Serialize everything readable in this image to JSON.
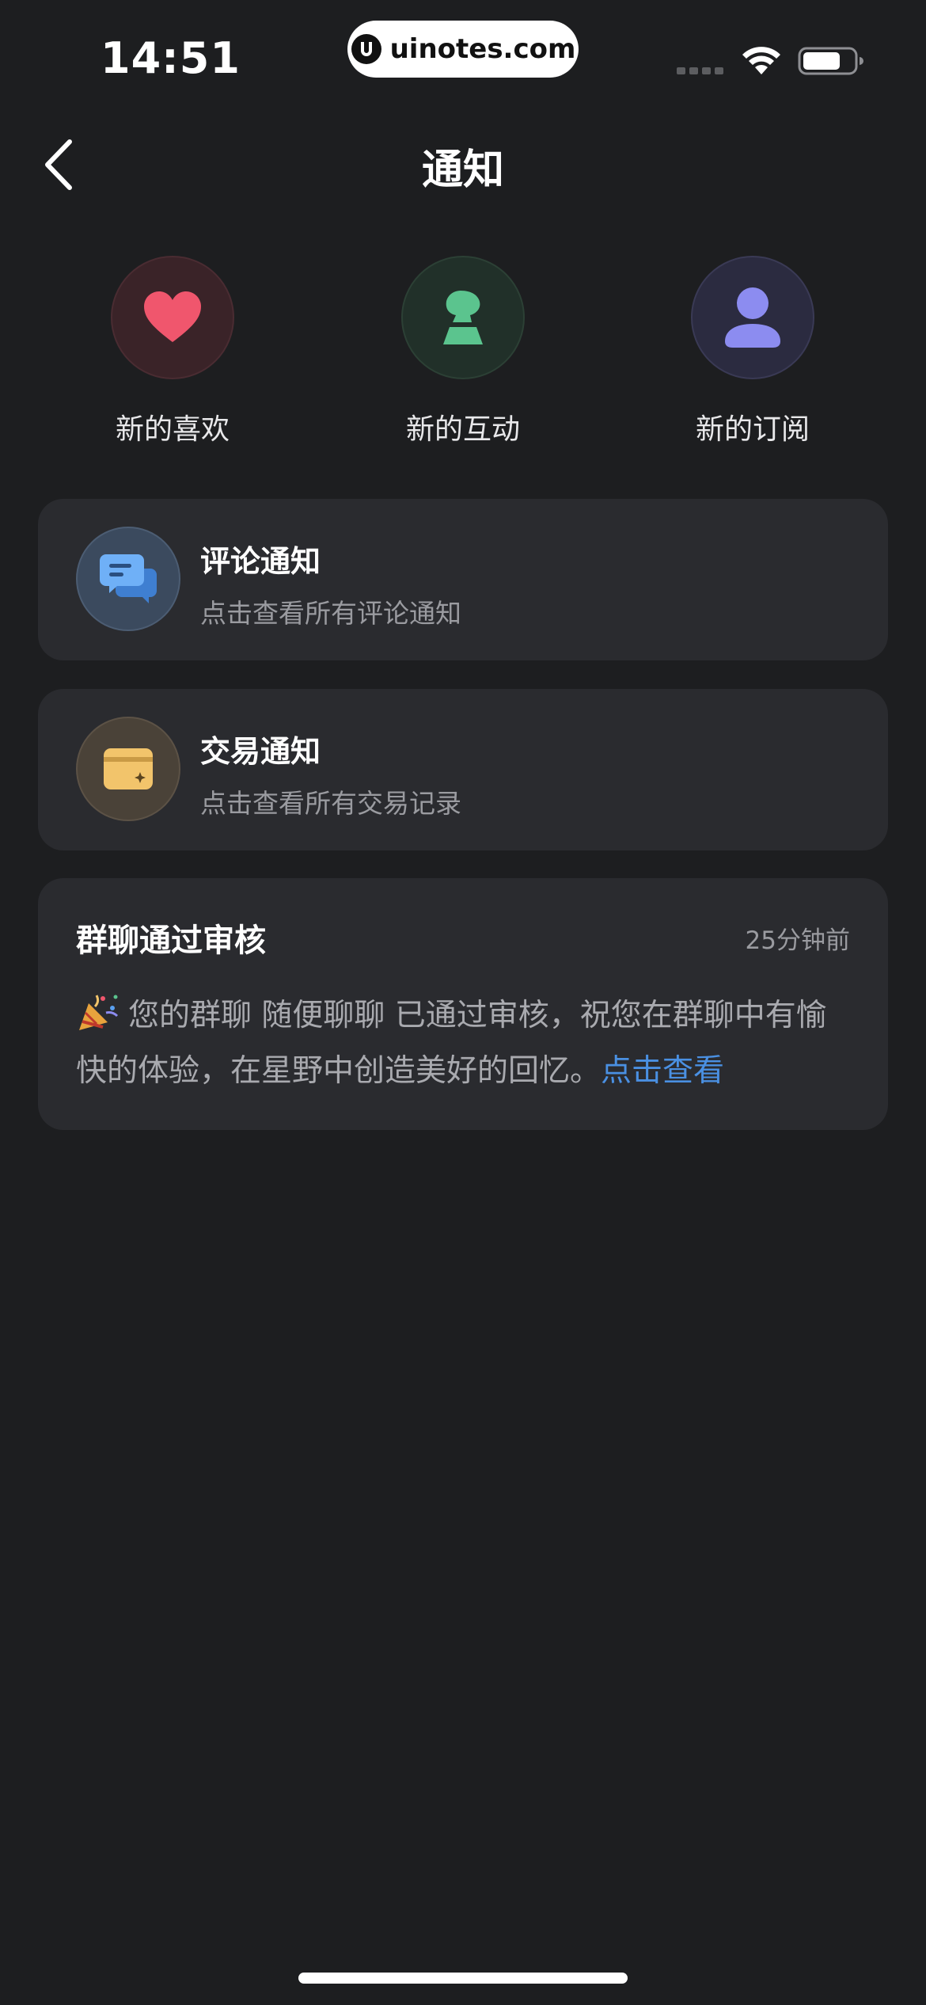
{
  "status_bar": {
    "time": "14:51",
    "watermark": "uinotes.com"
  },
  "nav": {
    "title": "通知",
    "back_icon": "chevron-left-icon"
  },
  "quick_actions": [
    {
      "label": "新的喜欢",
      "icon": "heart-icon",
      "color": "#f0566d"
    },
    {
      "label": "新的互动",
      "icon": "chess-piece-icon",
      "color": "#5bc48e"
    },
    {
      "label": "新的订阅",
      "icon": "person-icon",
      "color": "#8c8cf0"
    }
  ],
  "notify_cards": [
    {
      "title": "评论通知",
      "subtitle": "点击查看所有评论通知",
      "icon": "chat-bubbles-icon",
      "color": "#5aa0f0"
    },
    {
      "title": "交易通知",
      "subtitle": "点击查看所有交易记录",
      "icon": "wallet-card-icon",
      "color": "#f2c46b"
    }
  ],
  "message": {
    "title": "群聊通过审核",
    "time": "25分钟前",
    "emoji_icon": "party-popper-icon",
    "body": "您的群聊 随便聊聊 已通过审核，祝您在群聊中有愉快的体验，在星野中创造美好的回忆。",
    "link": "点击查看",
    "link_color": "#4a90e2"
  },
  "colors": {
    "background": "#1d1e20",
    "card": "#2a2b2f"
  }
}
